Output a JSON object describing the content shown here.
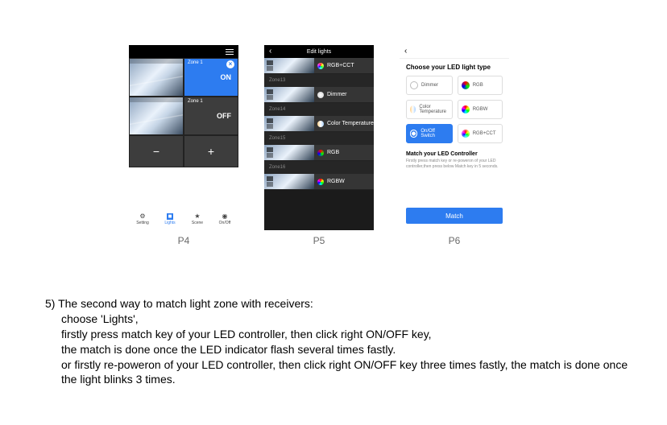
{
  "p4": {
    "zone1_label": "Zone 1",
    "on": "ON",
    "off": "OFF",
    "minus": "−",
    "plus": "+",
    "nav": {
      "setting": "Setting",
      "lights": "Lights",
      "scene": "Scene",
      "onoff": "On/Off"
    }
  },
  "p5": {
    "title": "Edit lights",
    "items": [
      {
        "name": "RGB+CCT",
        "dot": "dot-rgbcct"
      },
      {
        "name": "Dimmer",
        "dot": "dot-dimmer"
      },
      {
        "name": "Color Temperature",
        "dot": "dot-ct"
      },
      {
        "name": "RGB",
        "dot": "dot-rgb"
      },
      {
        "name": "RGBW",
        "dot": "dot-rgbw"
      }
    ],
    "zones": [
      "Zone13",
      "Zone14",
      "Zone15",
      "Zone16"
    ]
  },
  "p6": {
    "header": "Choose your LED light type",
    "opts": {
      "dimmer": "Dimmer",
      "rgb": "RGB",
      "ct": "Color Temperature",
      "rgbw": "RGBW",
      "onoff": "On/Off Switch",
      "rgbcct": "RGB+CCT"
    },
    "sub": "Match your LED Controller",
    "txt": "Firstly press match key or re-poweron of your LED controller,then press below Match key in 5 seconds.",
    "btn": "Match"
  },
  "captions": {
    "p4": "P4",
    "p5": "P5",
    "p6": "P6"
  },
  "instr": {
    "l1": "5) The second way to match light zone with receivers:",
    "l2": "choose 'Lights',",
    "l3": "firstly press match key of your LED controller, then click right ON/OFF key,",
    "l4": "the match is done once the LED indicator flash several times fastly.",
    "l5": "or firstly re-poweron of your LED controller, then click right ON/OFF key three times fastly, the match is done once the light blinks 3 times."
  }
}
